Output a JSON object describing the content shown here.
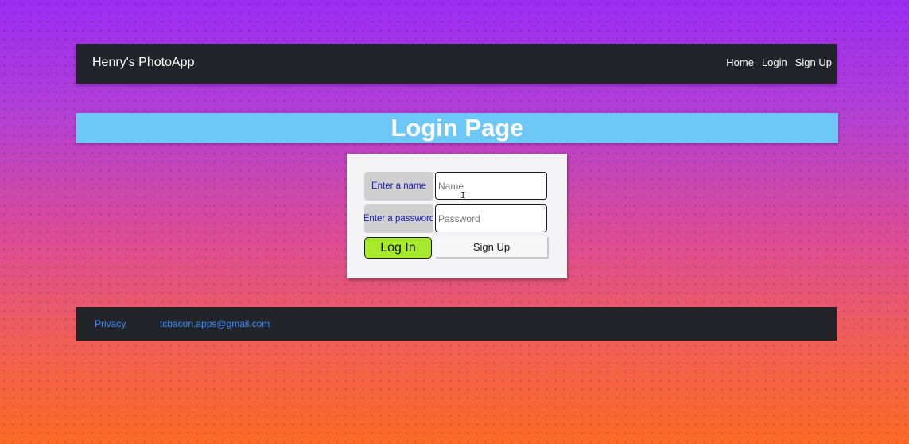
{
  "navbar": {
    "brand": "Henry's PhotoApp",
    "links": [
      "Home",
      "Login",
      "Sign Up"
    ]
  },
  "page": {
    "title": "Login Page"
  },
  "form": {
    "name_label": "Enter a name",
    "name_placeholder": "Name",
    "name_value": "",
    "password_label": "Enter a password",
    "password_placeholder": "Password",
    "password_value": "",
    "login_label": "Log In",
    "signup_label": "Sign Up"
  },
  "footer": {
    "privacy": "Privacy",
    "email": "tcbacon.apps@gmail.com"
  },
  "colors": {
    "navbar_bg": "#212529",
    "banner_bg": "#6ec8f7",
    "login_button": "#a6ea2b",
    "label_text": "#1a1ab0",
    "footer_link": "#3d8bfd"
  },
  "icons": {
    "cursor": "text-cursor-icon"
  }
}
